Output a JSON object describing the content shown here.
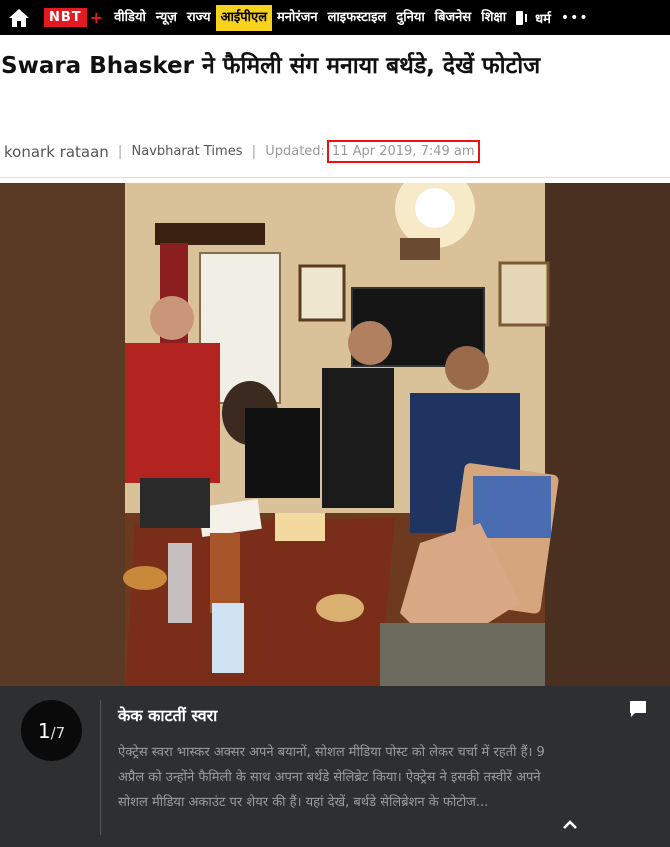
{
  "nav": {
    "logo": "NBT",
    "logo_plus": "+",
    "items": [
      {
        "label": "वीडियो"
      },
      {
        "label": "न्यूज़"
      },
      {
        "label": "राज्य"
      },
      {
        "label": "आईपीएल"
      },
      {
        "label": "मनोरंजन"
      },
      {
        "label": "लाइफस्टाइल"
      },
      {
        "label": "दुनिया"
      },
      {
        "label": "बिजनेस"
      },
      {
        "label": "शिक्षा"
      }
    ],
    "tail_label": "धर्म",
    "more": "•••",
    "active_color": "#f6d21c",
    "logo_color": "#e21b22"
  },
  "article": {
    "headline": "Swara Bhasker ने फैमिली संग मनाया बर्थडे, देखें फोटोज",
    "author": "konark rataan",
    "source": "Navbharat Times",
    "updated_label": "Updated:",
    "updated_date": "11 Apr 2019, 7:49 am"
  },
  "gallery": {
    "current": "1",
    "total": "/7",
    "caption_title": "केक काटतीं स्वरा",
    "caption_text": "ऐक्ट्रेस स्वरा भास्कर अक्सर अपने बयानों, सोशल मीडिया पोस्ट को लेकर चर्चा में रहती हैं। 9 अप्रैल को उन्होंने फैमिली के साथ अपना बर्थडे सेलिब्रेट किया। ऐक्ट्रेस ने इसकी तस्वीरें अपने सोशल मीडिया अकाउंट पर शेयर की हैं। यहां देखें, बर्थडे सेलिब्रेशन के फोटोज..."
  }
}
